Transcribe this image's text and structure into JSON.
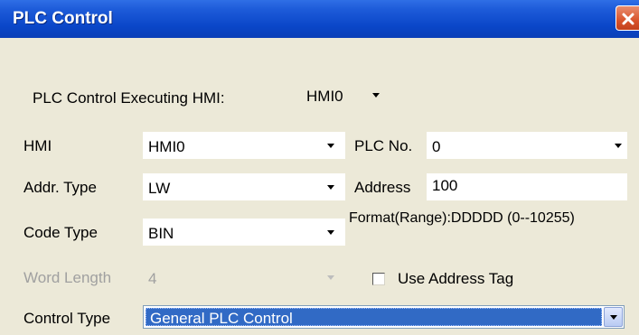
{
  "window": {
    "title": "PLC Control"
  },
  "executing_hmi": {
    "label": "PLC Control Executing HMI:",
    "value": "HMI0"
  },
  "hmi": {
    "label": "HMI",
    "value": "HMI0"
  },
  "plc_no": {
    "label": "PLC No.",
    "value": "0"
  },
  "addr_type": {
    "label": "Addr. Type",
    "value": "LW"
  },
  "address": {
    "label": "Address",
    "value": "100"
  },
  "code_type": {
    "label": "Code Type",
    "value": "BIN"
  },
  "format_range": {
    "text": "Format(Range):DDDDD (0--10255)"
  },
  "word_length": {
    "label": "Word Length",
    "value": "4"
  },
  "use_address_tag": {
    "label": "Use Address Tag",
    "checked": false
  },
  "control_type": {
    "label": "Control Type",
    "value": "General PLC Control"
  },
  "colors": {
    "titlebar": "#0a46c8",
    "selection": "#316ac5",
    "dialog_bg": "#ece9d8",
    "close_button": "#d9542c"
  },
  "icons": [
    "close-icon",
    "chevron-down-icon"
  ]
}
